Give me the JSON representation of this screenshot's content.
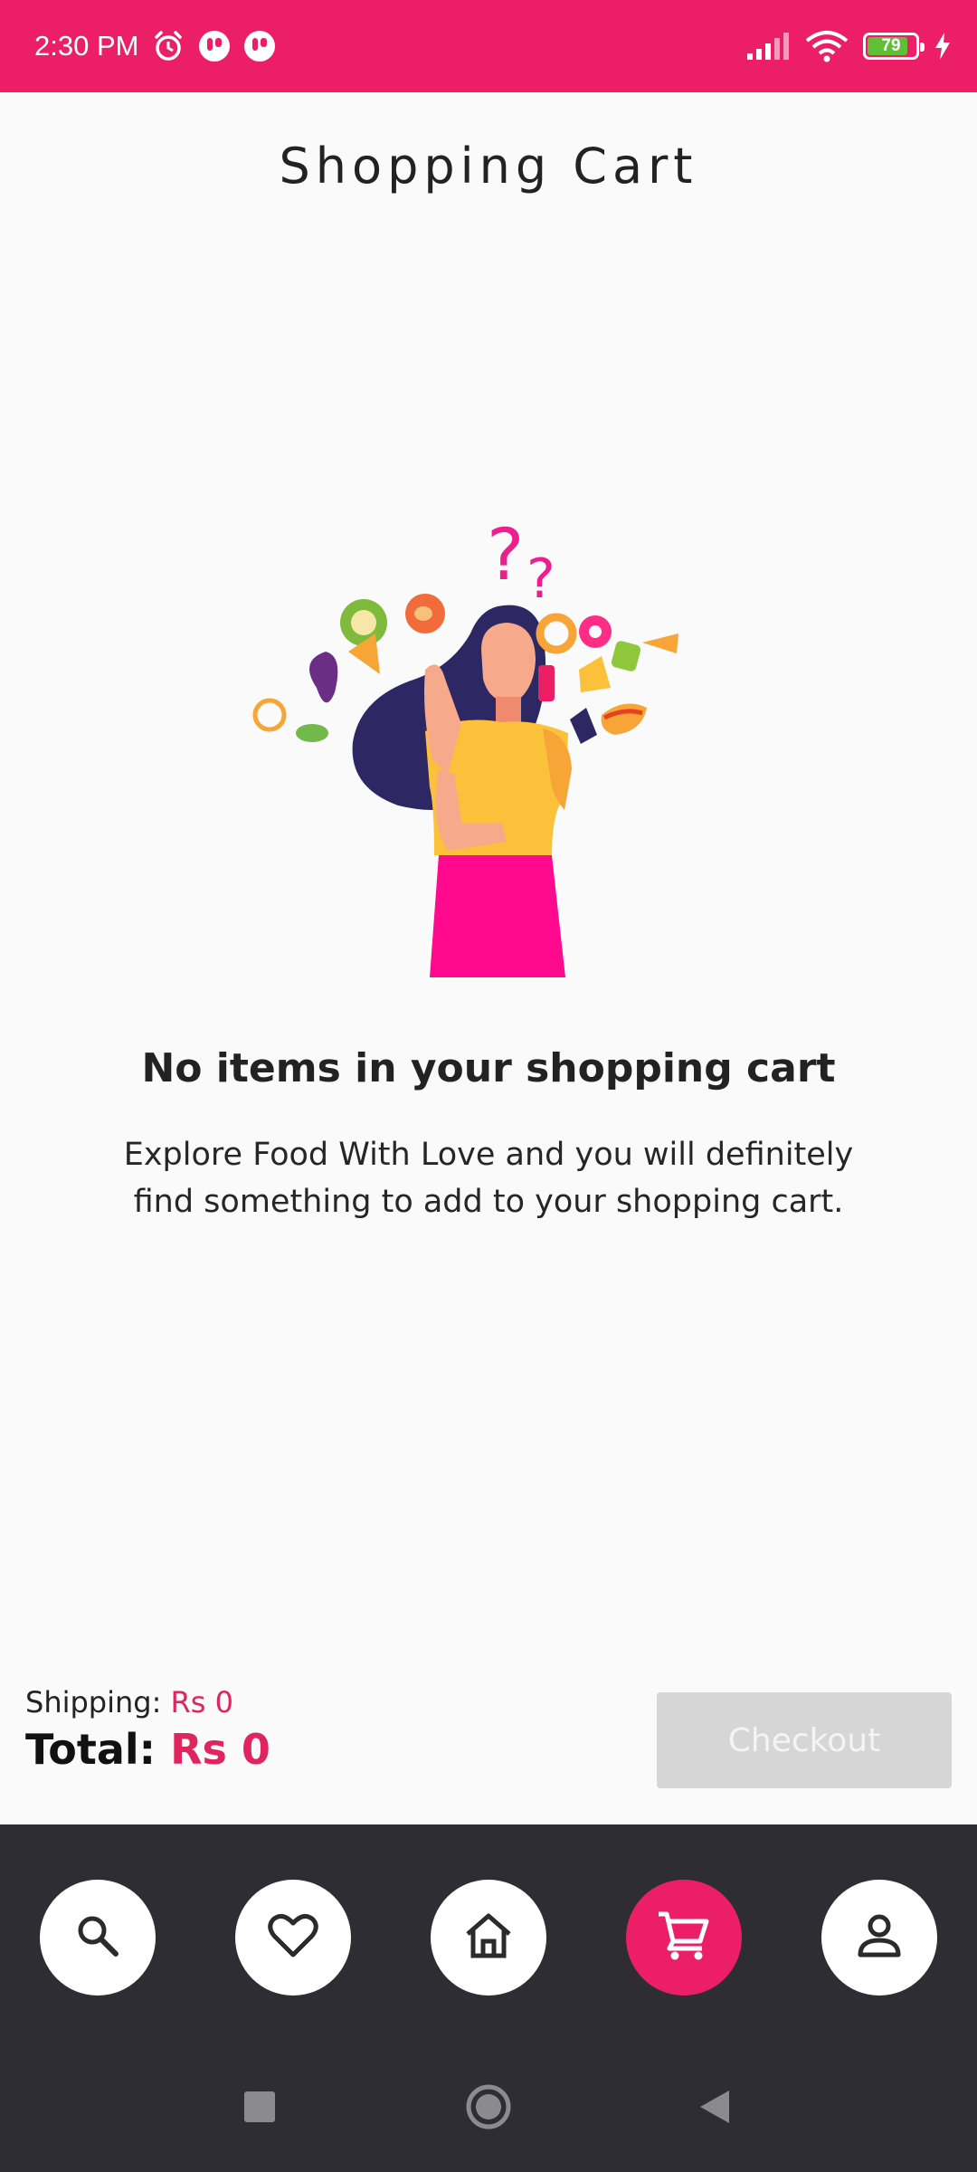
{
  "status_bar": {
    "time": "2:30 PM",
    "battery_level": "79",
    "background_color": "#ec1f66",
    "icons": [
      "alarm-icon",
      "app-notification-icon",
      "app-notification-icon",
      "signal-icon",
      "wifi-icon",
      "battery-icon",
      "charging-icon"
    ]
  },
  "header": {
    "title": "Shopping Cart"
  },
  "empty_state": {
    "illustration": "thinking-woman-food-illustration",
    "title": "No items in your shopping cart",
    "message": "Explore Food With Love and you will definitely find something to add to your shopping cart."
  },
  "totals": {
    "shipping_label": "Shipping:",
    "shipping_value": "Rs 0",
    "total_label": "Total:",
    "total_value": "Rs 0",
    "accent_color": "#e0245e"
  },
  "checkout": {
    "label": "Checkout",
    "enabled": false
  },
  "bottom_nav": {
    "items": [
      {
        "name": "search",
        "icon": "search-icon",
        "active": false
      },
      {
        "name": "favorites",
        "icon": "heart-icon",
        "active": false
      },
      {
        "name": "home",
        "icon": "home-icon",
        "active": false
      },
      {
        "name": "cart",
        "icon": "cart-icon",
        "active": true
      },
      {
        "name": "profile",
        "icon": "person-icon",
        "active": false
      }
    ]
  },
  "system_nav": [
    "recents-button",
    "home-button",
    "back-button"
  ]
}
